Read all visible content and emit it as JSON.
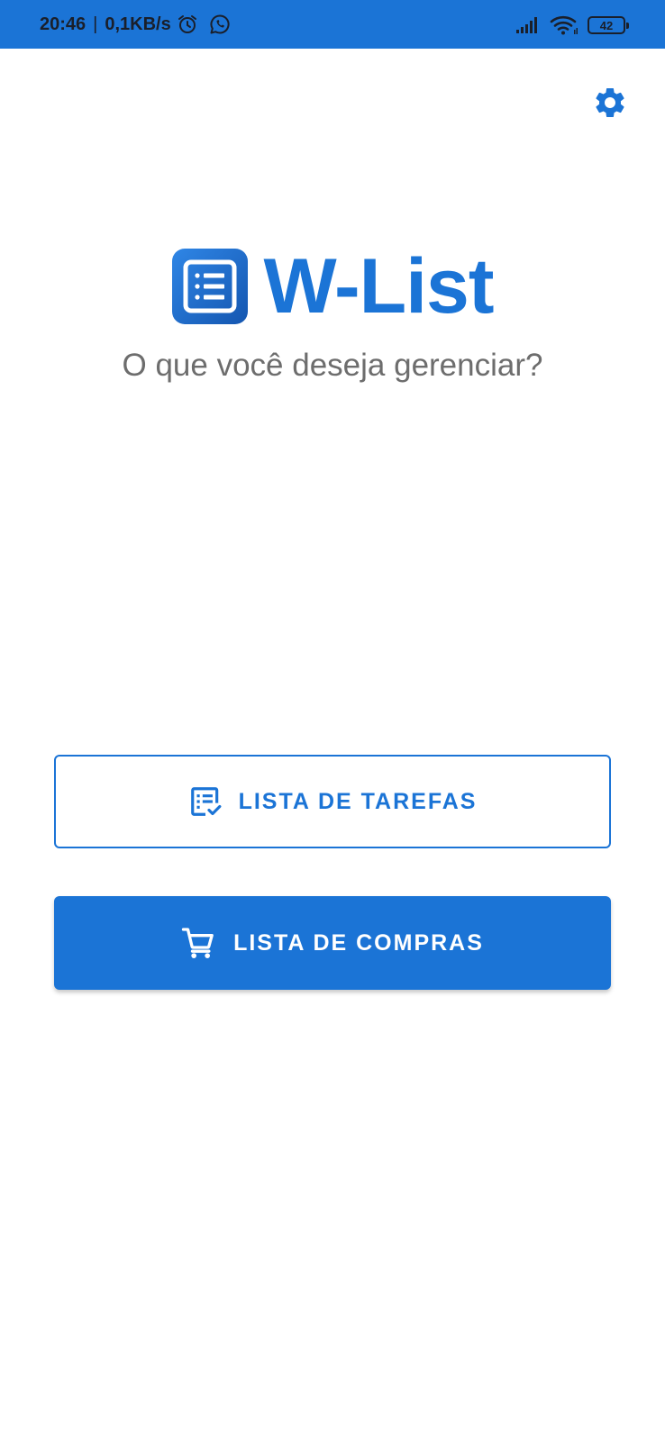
{
  "status_bar": {
    "time": "20:46",
    "separator": "|",
    "net_speed": "0,1KB/s",
    "battery_level": "42"
  },
  "app": {
    "name": "W-List",
    "subtitle": "O que você deseja gerenciar?"
  },
  "actions": {
    "tasks_label": "LISTA DE TAREFAS",
    "shopping_label": "LISTA DE COMPRAS"
  },
  "colors": {
    "primary": "#1b74d6",
    "status_bar": "#1b74d6",
    "subtitle_text": "#6d6d6d",
    "background": "#ffffff"
  },
  "icons": {
    "settings": "gear-icon",
    "logo": "list-icon",
    "tasks": "checklist-icon",
    "shopping": "cart-icon",
    "alarm": "alarm-clock-icon",
    "whatsapp": "whatsapp-icon",
    "signal": "signal-icon",
    "wifi": "wifi-icon",
    "battery": "battery-icon"
  }
}
